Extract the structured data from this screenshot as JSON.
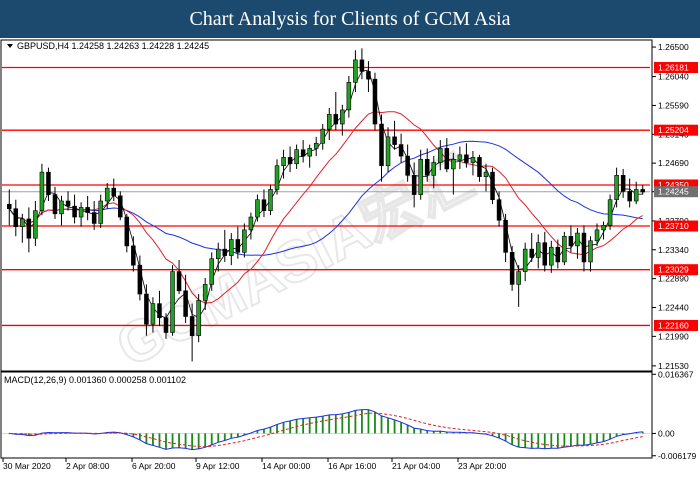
{
  "header": {
    "title": "Chart Analysis for Clients of GCM Asia"
  },
  "chart_data": [
    {
      "type": "candlestick",
      "symbol_line": "GBPUSD,H4  1.24258 1.24263 1.24228 1.24245",
      "ylim": [
        1.2145,
        1.2661
      ],
      "y_ticks": [
        "1.26500",
        "1.26040",
        "1.25590",
        "1.25140",
        "1.24690",
        "1.24245",
        "1.23790",
        "1.23340",
        "1.22890",
        "1.22440",
        "1.21990",
        "1.21530"
      ],
      "x_ticks": [
        "30 Mar 2020",
        "2 Apr 08:00",
        "6 Apr 20:00",
        "9 Apr 12:00",
        "14 Apr 00:00",
        "16 Apr 16:00",
        "21 Apr 04:00",
        "23 Apr 20:00"
      ],
      "horizontal_levels": [
        {
          "label": "1.26181",
          "value": 1.26181,
          "color": "#ff0000"
        },
        {
          "label": "1.25204",
          "value": 1.25204,
          "color": "#ff0000"
        },
        {
          "label": "1.24350",
          "value": 1.2435,
          "color": "#ff0000"
        },
        {
          "label": "1.23710",
          "value": 1.2371,
          "color": "#ff0000"
        },
        {
          "label": "1.23029",
          "value": 1.23029,
          "color": "#ff0000"
        },
        {
          "label": "1.22160",
          "value": 1.2216,
          "color": "#ff0000"
        }
      ],
      "current_price": {
        "label": "1.24245",
        "value": 1.24245
      },
      "candles_ohlc": [
        [
          1.2405,
          1.2428,
          1.2372,
          1.2398
        ],
        [
          1.2398,
          1.2412,
          1.2355,
          1.237
        ],
        [
          1.237,
          1.239,
          1.2345,
          1.2382
        ],
        [
          1.2382,
          1.24,
          1.233,
          1.2352
        ],
        [
          1.2352,
          1.241,
          1.234,
          1.2395
        ],
        [
          1.2395,
          1.2468,
          1.2388,
          1.2455
        ],
        [
          1.2455,
          1.2462,
          1.241,
          1.242
        ],
        [
          1.242,
          1.2432,
          1.2382,
          1.239
        ],
        [
          1.239,
          1.2418,
          1.2372,
          1.241
        ],
        [
          1.241,
          1.2425,
          1.2395,
          1.2402
        ],
        [
          1.2402,
          1.242,
          1.2375,
          1.2385
        ],
        [
          1.2385,
          1.2408,
          1.237,
          1.24
        ],
        [
          1.24,
          1.2418,
          1.238,
          1.2392
        ],
        [
          1.2392,
          1.241,
          1.2365,
          1.2375
        ],
        [
          1.2375,
          1.242,
          1.2368,
          1.241
        ],
        [
          1.241,
          1.2438,
          1.2398,
          1.243
        ],
        [
          1.243,
          1.2445,
          1.241,
          1.2418
        ],
        [
          1.2418,
          1.2425,
          1.238,
          1.2385
        ],
        [
          1.2385,
          1.239,
          1.233,
          1.234
        ],
        [
          1.234,
          1.2355,
          1.23,
          1.231
        ],
        [
          1.231,
          1.2325,
          1.2255,
          1.2265
        ],
        [
          1.2265,
          1.228,
          1.22,
          1.2218
        ],
        [
          1.2218,
          1.226,
          1.2205,
          1.225
        ],
        [
          1.225,
          1.227,
          1.2215,
          1.2228
        ],
        [
          1.2228,
          1.2235,
          1.2195,
          1.2205
        ],
        [
          1.2205,
          1.231,
          1.22,
          1.23
        ],
        [
          1.23,
          1.2318,
          1.2265,
          1.227
        ],
        [
          1.227,
          1.2295,
          1.222,
          1.223
        ],
        [
          1.223,
          1.225,
          1.216,
          1.22
        ],
        [
          1.22,
          1.2265,
          1.219,
          1.2255
        ],
        [
          1.2255,
          1.229,
          1.224,
          1.228
        ],
        [
          1.228,
          1.233,
          1.227,
          1.232
        ],
        [
          1.232,
          1.2345,
          1.23,
          1.2335
        ],
        [
          1.2335,
          1.2365,
          1.2315,
          1.2325
        ],
        [
          1.2325,
          1.236,
          1.231,
          1.235
        ],
        [
          1.235,
          1.237,
          1.232,
          1.233
        ],
        [
          1.233,
          1.2375,
          1.2322,
          1.2365
        ],
        [
          1.2365,
          1.2392,
          1.235,
          1.2385
        ],
        [
          1.2385,
          1.242,
          1.2378,
          1.2412
        ],
        [
          1.2412,
          1.2428,
          1.2385,
          1.2395
        ],
        [
          1.2395,
          1.2435,
          1.2388,
          1.2428
        ],
        [
          1.2428,
          1.2475,
          1.242,
          1.2465
        ],
        [
          1.2465,
          1.249,
          1.2445,
          1.2478
        ],
        [
          1.2478,
          1.2495,
          1.2455,
          1.2468
        ],
        [
          1.2468,
          1.2498,
          1.246,
          1.249
        ],
        [
          1.249,
          1.2505,
          1.247,
          1.248
        ],
        [
          1.248,
          1.2498,
          1.2462,
          1.2492
        ],
        [
          1.2492,
          1.251,
          1.248,
          1.25
        ],
        [
          1.25,
          1.253,
          1.249,
          1.2522
        ],
        [
          1.2522,
          1.2555,
          1.2505,
          1.2545
        ],
        [
          1.2545,
          1.258,
          1.252,
          1.253
        ],
        [
          1.253,
          1.256,
          1.2512,
          1.2552
        ],
        [
          1.2552,
          1.2605,
          1.254,
          1.2595
        ],
        [
          1.2595,
          1.2645,
          1.258,
          1.263
        ],
        [
          1.263,
          1.2648,
          1.26,
          1.2612
        ],
        [
          1.2612,
          1.2628,
          1.258,
          1.26
        ],
        [
          1.26,
          1.261,
          1.252,
          1.253
        ],
        [
          1.253,
          1.2545,
          1.244,
          1.2465
        ],
        [
          1.2465,
          1.2525,
          1.2455,
          1.251
        ],
        [
          1.251,
          1.2535,
          1.249,
          1.2498
        ],
        [
          1.2498,
          1.2515,
          1.247,
          1.248
        ],
        [
          1.248,
          1.2498,
          1.244,
          1.245
        ],
        [
          1.245,
          1.247,
          1.24,
          1.242
        ],
        [
          1.242,
          1.249,
          1.2412,
          1.2475
        ],
        [
          1.2475,
          1.2492,
          1.244,
          1.245
        ],
        [
          1.245,
          1.248,
          1.243,
          1.247
        ],
        [
          1.247,
          1.2505,
          1.2458,
          1.2492
        ],
        [
          1.2492,
          1.2508,
          1.2455,
          1.246
        ],
        [
          1.246,
          1.2485,
          1.242,
          1.2475
        ],
        [
          1.2475,
          1.2495,
          1.246,
          1.2482
        ],
        [
          1.2482,
          1.25,
          1.2462,
          1.247
        ],
        [
          1.247,
          1.2488,
          1.245,
          1.2478
        ],
        [
          1.2478,
          1.2482,
          1.244,
          1.2448
        ],
        [
          1.2448,
          1.2468,
          1.2425,
          1.2455
        ],
        [
          1.2455,
          1.2462,
          1.2405,
          1.2412
        ],
        [
          1.2412,
          1.2425,
          1.237,
          1.238
        ],
        [
          1.238,
          1.239,
          1.2315,
          1.233
        ],
        [
          1.233,
          1.234,
          1.227,
          1.228
        ],
        [
          1.228,
          1.231,
          1.2245,
          1.23
        ],
        [
          1.23,
          1.2345,
          1.2285,
          1.2335
        ],
        [
          1.2335,
          1.236,
          1.2315,
          1.2322
        ],
        [
          1.2322,
          1.2358,
          1.2305,
          1.2345
        ],
        [
          1.2345,
          1.2362,
          1.23,
          1.231
        ],
        [
          1.231,
          1.2348,
          1.2298,
          1.2338
        ],
        [
          1.2338,
          1.235,
          1.2305,
          1.2315
        ],
        [
          1.2315,
          1.2362,
          1.231,
          1.2355
        ],
        [
          1.2355,
          1.2372,
          1.233,
          1.234
        ],
        [
          1.234,
          1.2368,
          1.232,
          1.236
        ],
        [
          1.236,
          1.2372,
          1.23,
          1.2315
        ],
        [
          1.2315,
          1.2355,
          1.23,
          1.2348
        ],
        [
          1.2348,
          1.2375,
          1.234,
          1.2365
        ],
        [
          1.2365,
          1.2378,
          1.235,
          1.2372
        ],
        [
          1.2372,
          1.242,
          1.2365,
          1.2412
        ],
        [
          1.2412,
          1.2462,
          1.24,
          1.245
        ],
        [
          1.245,
          1.246,
          1.2415,
          1.2425
        ],
        [
          1.2425,
          1.2445,
          1.24,
          1.241
        ],
        [
          1.241,
          1.244,
          1.2405,
          1.2428
        ],
        [
          1.2428,
          1.2435,
          1.242,
          1.2424
        ]
      ],
      "ma_fast_color": "#000000",
      "ma_mid_color": "#e0202a",
      "ma_slow_color": "#1c32e0",
      "macd": {
        "label": "MACD(12,26,9) 0.001360 0.000258 0.001102",
        "y_ticks": [
          "0.016367",
          "0.00",
          "-0.006179"
        ],
        "ylim": [
          -0.0068,
          0.017
        ],
        "histogram_color": "#1a8a1a",
        "signal_color": "#e0202a",
        "macd_line_color": "#1c32e0"
      }
    }
  ]
}
